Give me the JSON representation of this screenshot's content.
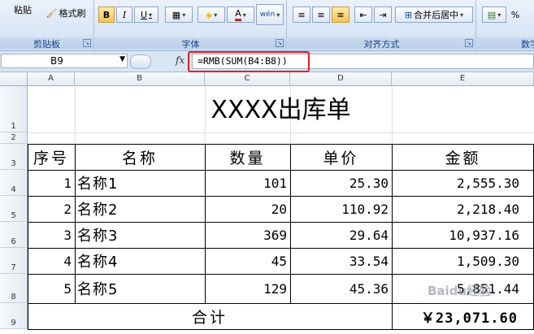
{
  "ribbon": {
    "paste_label": "粘贴",
    "format_painter_label": "格式刷",
    "groups": {
      "clipboard": "剪贴板",
      "font": "字体",
      "alignment": "对齐方式",
      "number": "数字"
    },
    "bold": "B",
    "italic": "I",
    "underline": "U",
    "font_color_glyph": "A",
    "phonetic_glyph": "wén",
    "merge_center_label": "合并后居中",
    "percent": "%"
  },
  "formula_bar": {
    "name_box": "B9",
    "fx": "fx",
    "formula": "=RMB(SUM(B4:B8))"
  },
  "columns": [
    "A",
    "B",
    "C",
    "D",
    "E"
  ],
  "rows": [
    "1",
    "2",
    "3",
    "4",
    "5",
    "6",
    "7",
    "8",
    "9"
  ],
  "sheet": {
    "title": "XXXX出库单",
    "headers": [
      "序号",
      "名称",
      "数量",
      "单价",
      "金额"
    ],
    "data": [
      [
        "1",
        "名称1",
        "101",
        "25.30",
        "2,555.30"
      ],
      [
        "2",
        "名称2",
        "20",
        "110.92",
        "2,218.40"
      ],
      [
        "3",
        "名称3",
        "369",
        "29.64",
        "10,937.16"
      ],
      [
        "4",
        "名称4",
        "45",
        "33.54",
        "1,509.30"
      ],
      [
        "5",
        "名称5",
        "129",
        "45.36",
        "5,851.44"
      ]
    ],
    "total_label": "合计",
    "total_value": "￥23,071.60"
  },
  "watermark": "Baidu经验"
}
